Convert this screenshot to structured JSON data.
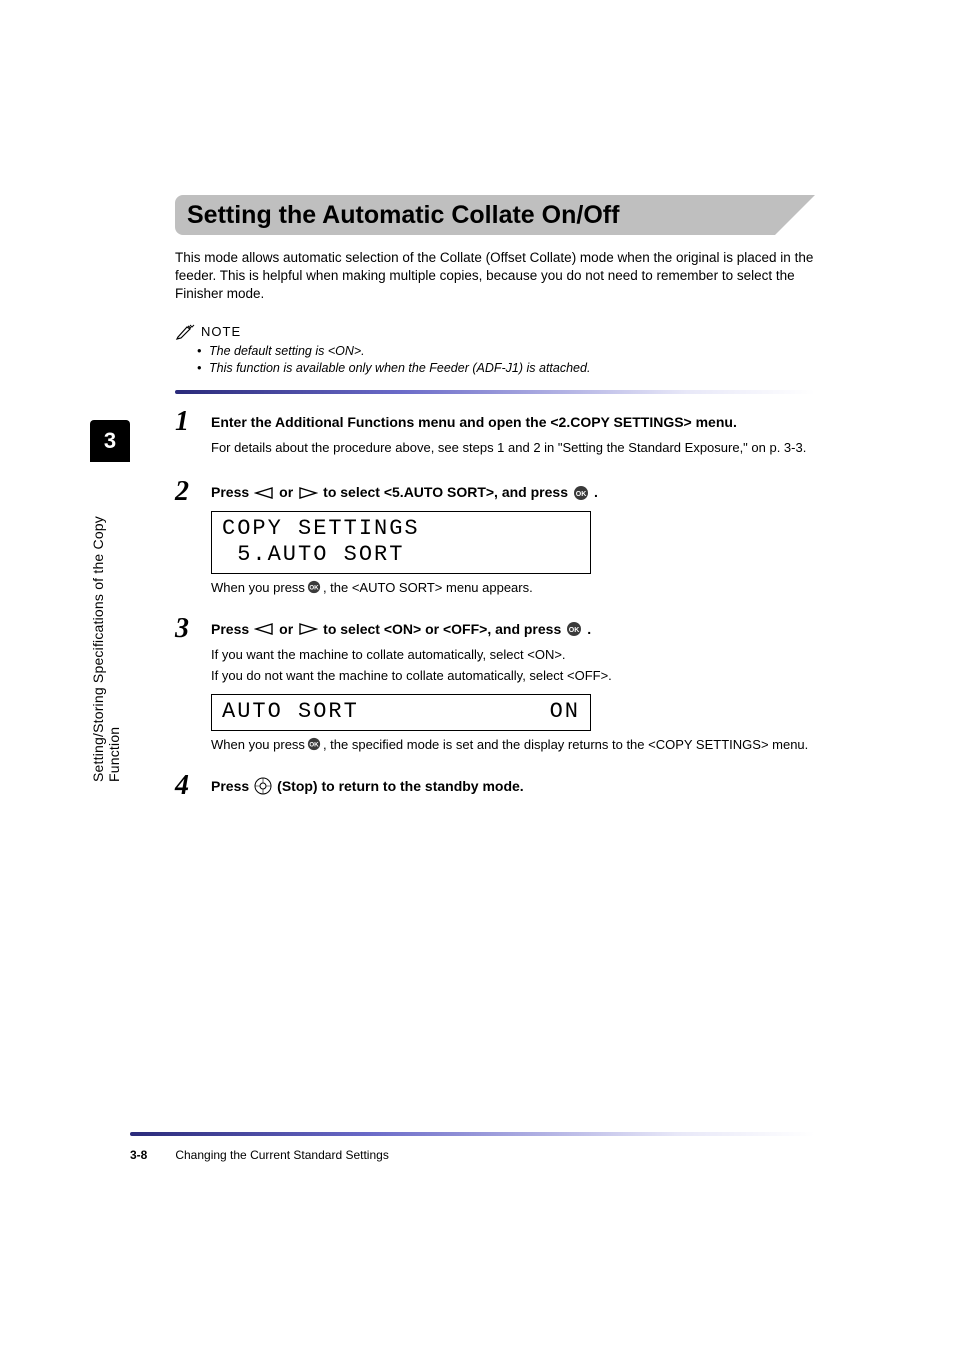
{
  "sidebar": {
    "chapter_num": "3",
    "chapter_label": "Setting/Storing Specifications of the Copy Function"
  },
  "heading": "Setting the Automatic Collate On/Off",
  "intro": "This mode allows automatic selection of the Collate (Offset Collate) mode when the original is placed in the feeder. This is helpful when making multiple copies, because you do not need to remember to select the Finisher mode.",
  "note": {
    "label": "NOTE",
    "items": [
      "The default setting is <ON>.",
      "This function is available only when the Feeder (ADF-J1) is attached."
    ]
  },
  "steps": [
    {
      "num": "1",
      "title_plain": "Enter the Additional Functions menu and open the <2.COPY SETTINGS> menu.",
      "body": "For details about the procedure above, see steps 1 and 2 in \"Setting the Standard Exposure,\" on p. 3-3."
    },
    {
      "num": "2",
      "title_parts": {
        "a": "Press ",
        "b": " or ",
        "c": " to select <5.AUTO SORT>, and press ",
        "d": "."
      },
      "lcd_line1": "COPY SETTINGS",
      "lcd_line2": " 5.AUTO SORT",
      "after_parts": {
        "a": "When you press ",
        "b": ", the <AUTO SORT> menu appears."
      }
    },
    {
      "num": "3",
      "title_parts": {
        "a": "Press ",
        "b": " or ",
        "c": " to select <ON> or <OFF>, and press ",
        "d": "."
      },
      "body_lines": [
        "If you want the machine to collate automatically, select <ON>.",
        "If you do not want the machine to collate automatically, select <OFF>."
      ],
      "lcd_left": "AUTO SORT",
      "lcd_right": "ON",
      "after_parts": {
        "a": "When you press ",
        "b": ", the specified mode is set and the display returns to the <COPY SETTINGS> menu."
      }
    },
    {
      "num": "4",
      "title_parts": {
        "a": "Press ",
        "b": " (Stop) to return to the standby mode."
      }
    }
  ],
  "footer": {
    "page": "3-8",
    "title": "Changing the Current Standard Settings"
  }
}
